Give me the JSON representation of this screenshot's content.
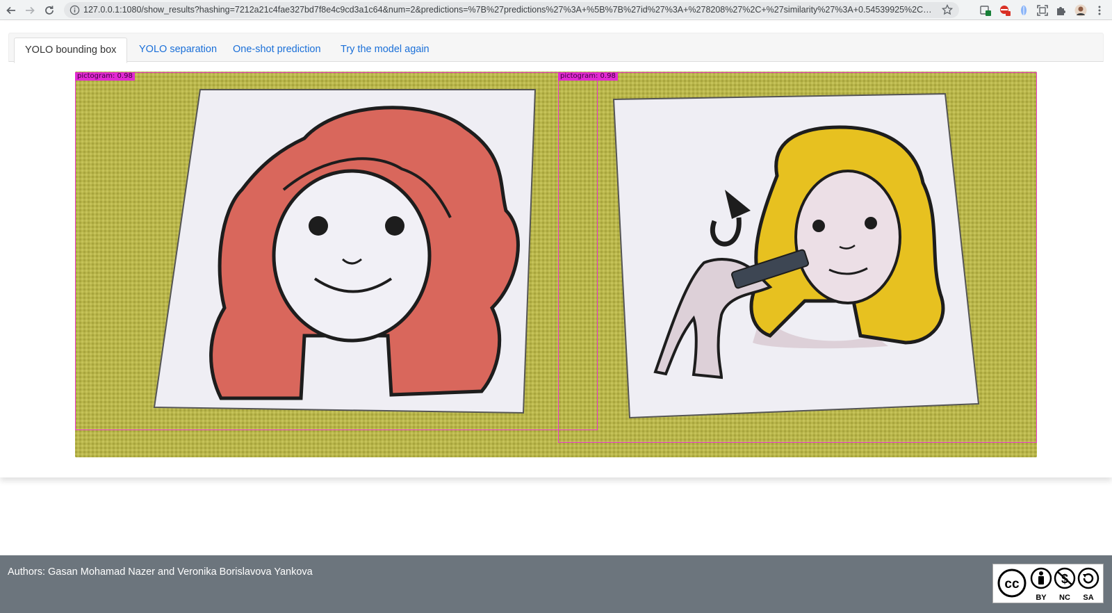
{
  "browser": {
    "url": "127.0.0.1:1080/show_results?hashing=7212a21c4fae327bd7f8e4c9cd3a1c64&num=2&predictions=%7B%27predictions%27%3A+%5B%7B%27id%27%3A+%278208%27%2C+%27similarity%27%3A+0.54539925%2C+%27p...",
    "accent": "#1a73e8"
  },
  "tabs": [
    {
      "label": "YOLO bounding box",
      "active": true
    },
    {
      "label": "YOLO separation",
      "active": false
    },
    {
      "label": "One-shot prediction",
      "active": false
    },
    {
      "label": "Try the model again",
      "active": false
    }
  ],
  "result": {
    "detections": [
      {
        "label": "pictogram: 0.98"
      },
      {
        "label": "pictogram: 0.98"
      }
    ],
    "box_color": "#ec3ad0"
  },
  "footer": {
    "authors": "Authors: Gasan Mohamad Nazer and Veronika Borislavova Yankova",
    "license_labels": [
      "BY",
      "NC",
      "SA"
    ],
    "background": "#6c757d"
  }
}
